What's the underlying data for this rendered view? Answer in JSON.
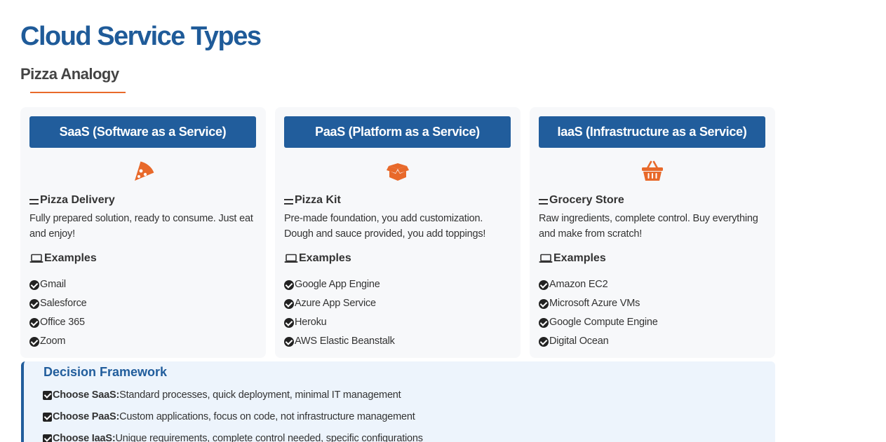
{
  "page": {
    "title": "Cloud Service Types",
    "subtitle": "Pizza Analogy"
  },
  "colors": {
    "primary": "#215d9c",
    "accent": "#e8692a",
    "card_bg": "#f7f8fa",
    "decision_bg": "#edf4fc"
  },
  "cards": [
    {
      "header": "SaaS (Software as a Service)",
      "icon": "pizza-slice-icon",
      "analogy": "Pizza Delivery",
      "description": "Fully prepared solution, ready to consume. Just eat and enjoy!",
      "examples_heading": "Examples",
      "examples": [
        "Gmail",
        "Salesforce",
        "Office 365",
        "Zoom"
      ]
    },
    {
      "header": "PaaS (Platform as a Service)",
      "icon": "box-open-icon",
      "analogy": "Pizza Kit",
      "description": "Pre-made foundation, you add customization. Dough and sauce provided, you add toppings!",
      "examples_heading": "Examples",
      "examples": [
        "Google App Engine",
        "Azure App Service",
        "Heroku",
        "AWS Elastic Beanstalk"
      ]
    },
    {
      "header": "IaaS (Infrastructure as a Service)",
      "icon": "shopping-basket-icon",
      "analogy": "Grocery Store",
      "description": "Raw ingredients, complete control. Buy everything and make from scratch!",
      "examples_heading": "Examples",
      "examples": [
        "Amazon EC2",
        "Microsoft Azure VMs",
        "Google Compute Engine",
        "Digital Ocean"
      ]
    }
  ],
  "decision": {
    "title": "Decision Framework",
    "items": [
      {
        "label": "Choose SaaS:",
        "text": "Standard processes, quick deployment, minimal IT management"
      },
      {
        "label": "Choose PaaS:",
        "text": "Custom applications, focus on code, not infrastructure management"
      },
      {
        "label": "Choose IaaS:",
        "text": "Unique requirements, complete control needed, specific configurations"
      }
    ]
  }
}
